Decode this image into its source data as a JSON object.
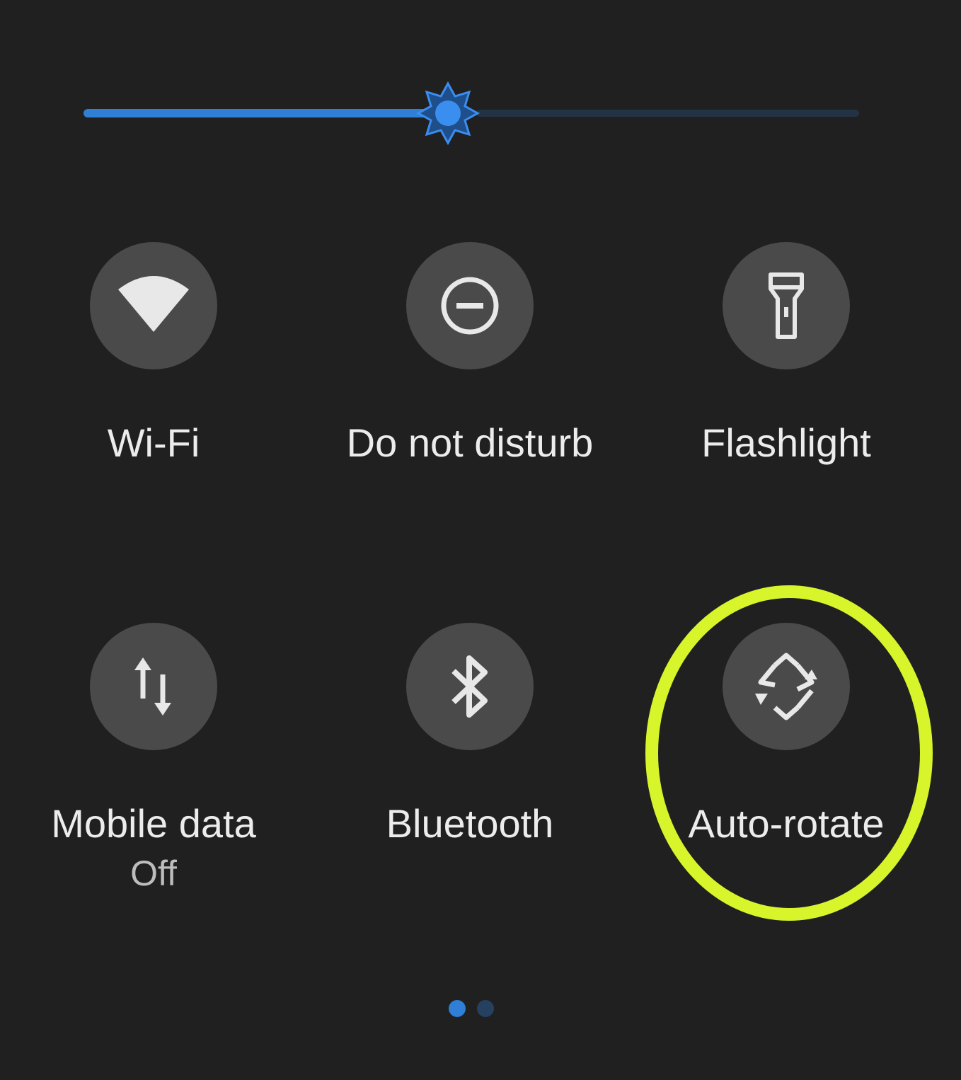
{
  "brightness": {
    "level": 0.47,
    "active_color": "#2f7fd6",
    "inactive_color": "#243245",
    "icon": "brightness-icon"
  },
  "tiles": [
    {
      "label": "Wi-Fi",
      "sublabel": "",
      "icon": "wifi-icon"
    },
    {
      "label": "Do not disturb",
      "sublabel": "",
      "icon": "do-not-disturb-icon"
    },
    {
      "label": "Flashlight",
      "sublabel": "",
      "icon": "flashlight-icon"
    },
    {
      "label": "Mobile data",
      "sublabel": "Off",
      "icon": "mobile-data-icon"
    },
    {
      "label": "Bluetooth",
      "sublabel": "",
      "icon": "bluetooth-icon"
    },
    {
      "label": "Auto-rotate",
      "sublabel": "",
      "icon": "auto-rotate-icon"
    }
  ],
  "highlight_color": "#d7f52a",
  "pager": {
    "pages": 2,
    "current": 1,
    "active_color": "#2f7fd6",
    "inactive_color": "#25415f"
  }
}
